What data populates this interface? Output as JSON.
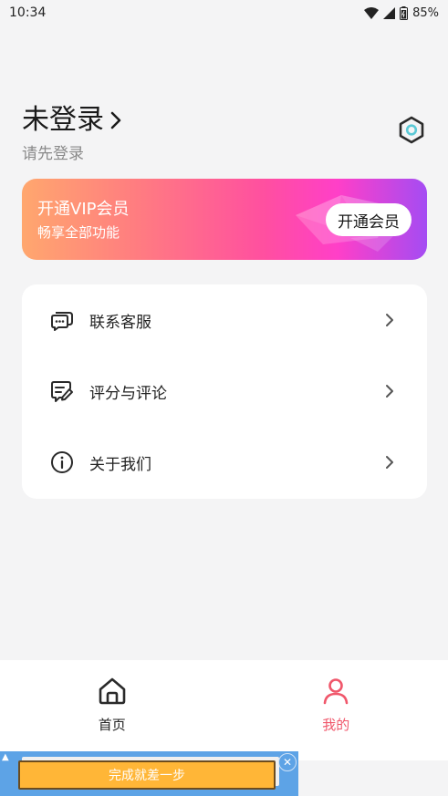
{
  "status_bar": {
    "time": "10:34",
    "battery": "85%"
  },
  "profile": {
    "title": "未登录",
    "subtitle": "请先登录"
  },
  "vip": {
    "title": "开通VIP会员",
    "subtitle": "畅享全部功能",
    "button": "开通会员"
  },
  "menu": {
    "items": [
      {
        "label": "联系客服",
        "icon": "customer-service-icon"
      },
      {
        "label": "评分与评论",
        "icon": "rating-review-icon"
      },
      {
        "label": "关于我们",
        "icon": "info-icon"
      }
    ]
  },
  "nav": {
    "items": [
      {
        "label": "首页",
        "icon": "home-icon",
        "active": false
      },
      {
        "label": "我的",
        "icon": "user-icon",
        "active": true
      }
    ]
  },
  "ad": {
    "button": "完成就差一步"
  },
  "colors": {
    "accent": "#f0576b",
    "background": "#f4f4f5"
  }
}
